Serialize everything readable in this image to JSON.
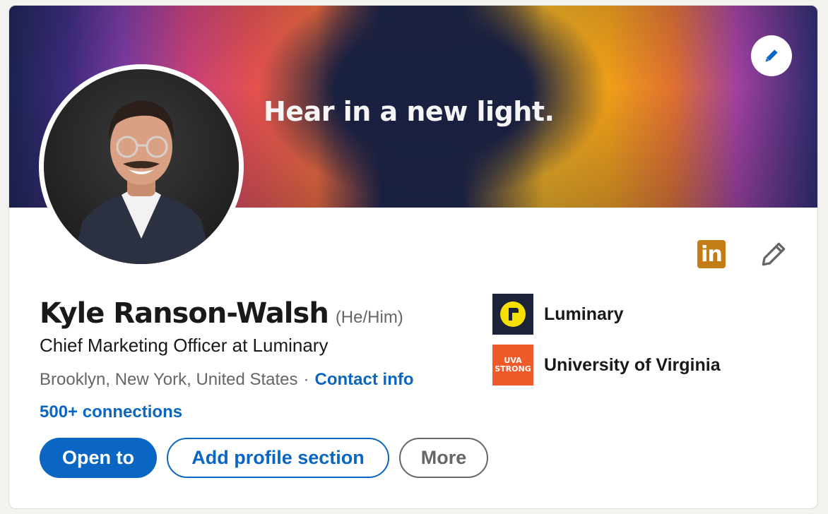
{
  "banner": {
    "tagline": "Hear in a new light."
  },
  "profile": {
    "name": "Kyle Ranson-Walsh",
    "pronouns": "(He/Him)",
    "headline": "Chief Marketing Officer at Luminary",
    "location": "Brooklyn, New York, United States",
    "separator": "·",
    "contact_link": "Contact info",
    "connections": "500+ connections"
  },
  "top_icons": {
    "linkedin_badge": "in"
  },
  "buttons": {
    "open_to": "Open to",
    "add_section": "Add profile section",
    "more": "More"
  },
  "organizations": [
    {
      "name": "Luminary",
      "icon": "luminary-logo"
    },
    {
      "name": "University of Virginia",
      "icon": "uva-logo",
      "logo_text_1": "UVA",
      "logo_text_2": "STRONG"
    }
  ],
  "colors": {
    "primary": "#0a66c2",
    "linkedin_badge": "#c37d16",
    "uva_orange": "#f05a28",
    "luminary_bg": "#1c2238",
    "luminary_yellow": "#f6e000"
  }
}
